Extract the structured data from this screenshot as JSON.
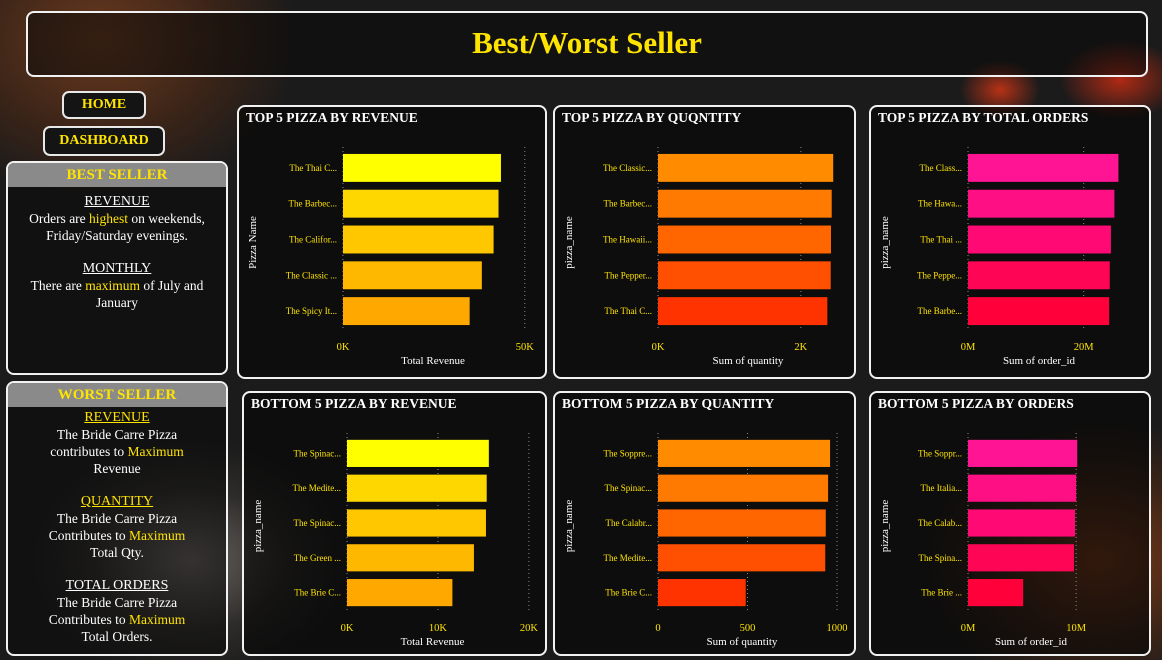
{
  "header": {
    "title": "Best/Worst Seller"
  },
  "nav": {
    "home_label": "HOME",
    "dashboard_label": "DASHBOARD"
  },
  "best_seller": {
    "heading": "BEST SELLER",
    "revenue_title": "REVENUE",
    "revenue_pre": "Orders are",
    "revenue_highlight": "highest",
    "revenue_post": "on weekends, Friday/Saturday evenings.",
    "monthly_title": "MONTHLY",
    "monthly_pre": "There are",
    "monthly_highlight": "maximum",
    "monthly_post": "of July and January"
  },
  "worst_seller": {
    "heading": "WORST SELLER",
    "revenue_title": "REVENUE",
    "revenue_line1": "The Bride Carre Pizza",
    "revenue_pre": "contributes to",
    "revenue_highlight": "Maximum",
    "revenue_post": "Revenue",
    "quantity_title": "QUANTITY",
    "quantity_line1": "The Bride Carre Pizza",
    "quantity_pre": "Contributes to",
    "quantity_highlight": "Maximum",
    "quantity_post": "Total Qty.",
    "orders_title": "TOTAL ORDERS",
    "orders_line1": "The Bride Carre Pizza",
    "orders_pre": "Contributes to",
    "orders_highlight": "Maximum",
    "orders_post": "Total Orders."
  },
  "chart_data": [
    {
      "id": "top-revenue",
      "type": "bar",
      "title": "TOP 5 PIZZA BY REVENUE",
      "ylabel": "Pizza Name",
      "xlabel": "Total Revenue",
      "categories": [
        "The Thai C...",
        "The Barbec...",
        "The Califor...",
        "The Classic ...",
        "The Spicy It..."
      ],
      "values": [
        43434,
        42768,
        41410,
        38180,
        34831
      ],
      "xlim": [
        0,
        55000
      ],
      "ticks": [
        0,
        50000
      ],
      "tick_labels": [
        "0K",
        "50K"
      ],
      "colors": [
        "#ffff00",
        "#ffd700",
        "#ffc700",
        "#ffb800",
        "#ffa800"
      ]
    },
    {
      "id": "top-quantity",
      "type": "bar",
      "title": "TOP 5 PIZZA BY QUQNTITY",
      "ylabel": "pizza_name",
      "xlabel": "Sum of quantity",
      "categories": [
        "The Classic...",
        "The Barbec...",
        "The Hawaii...",
        "The Pepper...",
        "The Thai C..."
      ],
      "values": [
        2453,
        2432,
        2422,
        2418,
        2371
      ],
      "xlim": [
        0,
        2800
      ],
      "ticks": [
        0,
        2000
      ],
      "tick_labels": [
        "0K",
        "2K"
      ],
      "colors": [
        "#ff8c00",
        "#ff7a00",
        "#ff6600",
        "#ff4f00",
        "#ff3300"
      ]
    },
    {
      "id": "top-orders",
      "type": "bar",
      "title": "TOP 5 PIZZA BY TOTAL ORDERS",
      "ylabel": "pizza_name",
      "xlabel": "Sum of order_id",
      "categories": [
        "The Class...",
        "The Hawa...",
        "The Thai ...",
        "The Peppe...",
        "The Barbe..."
      ],
      "values": [
        26000000,
        25300000,
        24700000,
        24500000,
        24400000
      ],
      "xlim": [
        0,
        28000000
      ],
      "ticks": [
        0,
        20000000
      ],
      "tick_labels": [
        "0M",
        "20M"
      ],
      "colors": [
        "#ff1493",
        "#ff0f84",
        "#ff0a75",
        "#ff0555",
        "#ff003a"
      ]
    },
    {
      "id": "bottom-revenue",
      "type": "bar",
      "title": "BOTTOM 5 PIZZA BY REVENUE",
      "ylabel": "pizza_name",
      "xlabel": "Total Revenue",
      "categories": [
        "The Spinac...",
        "The Medite...",
        "The Spinac...",
        "The Green ...",
        "The Brie C..."
      ],
      "values": [
        15596,
        15360,
        15278,
        13956,
        11588
      ],
      "xlim": [
        0,
        21000
      ],
      "ticks": [
        0,
        10000,
        20000
      ],
      "tick_labels": [
        "0K",
        "10K",
        "20K"
      ],
      "colors": [
        "#ffff00",
        "#ffd700",
        "#ffc700",
        "#ffb800",
        "#ffa800"
      ]
    },
    {
      "id": "bottom-quantity",
      "type": "bar",
      "title": "BOTTOM 5 PIZZA BY QUANTITY",
      "ylabel": "pizza_name",
      "xlabel": "Sum of quantity",
      "categories": [
        "The Soppre...",
        "The Spinac...",
        "The Calabr...",
        "The Medite...",
        "The Brie C..."
      ],
      "values": [
        961,
        950,
        937,
        934,
        490
      ],
      "xlim": [
        0,
        1050
      ],
      "ticks": [
        0,
        500,
        1000
      ],
      "tick_labels": [
        "0",
        "500",
        "1000"
      ],
      "colors": [
        "#ff8c00",
        "#ff7a00",
        "#ff6600",
        "#ff4f00",
        "#ff3300"
      ]
    },
    {
      "id": "bottom-orders",
      "type": "bar",
      "title": "BOTTOM 5 PIZZA BY ORDERS",
      "ylabel": "pizza_name",
      "xlabel": "Sum of order_id",
      "categories": [
        "The Soppr...",
        "The Italia...",
        "The Calab...",
        "The Spina...",
        "The Brie ..."
      ],
      "values": [
        10100000,
        10000000,
        9900000,
        9800000,
        5100000
      ],
      "xlim": [
        0,
        13500000
      ],
      "ticks": [
        0,
        10000000
      ],
      "tick_labels": [
        "0M",
        "10M"
      ],
      "colors": [
        "#ff1493",
        "#ff0f84",
        "#ff0a75",
        "#ff0555",
        "#ff003a"
      ]
    }
  ]
}
